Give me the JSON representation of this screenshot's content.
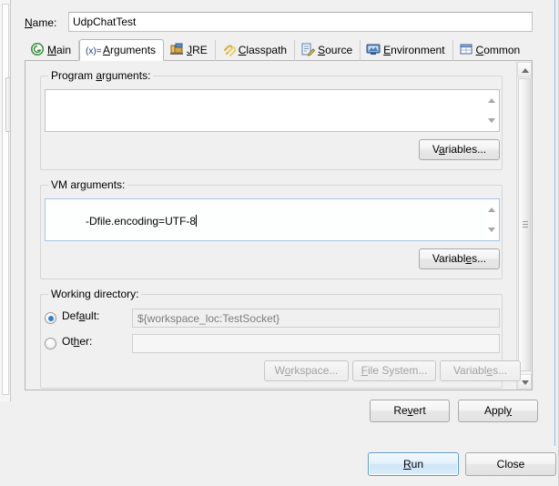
{
  "dialog": {
    "name_label": "Name:",
    "name_label_mnemonic": "N",
    "name_value": "UdpChatTest"
  },
  "tabs": [
    {
      "id": "main",
      "label": "Main",
      "mnemonic": "M",
      "icon": "green-circle-g-icon",
      "active": false
    },
    {
      "id": "arguments",
      "label": "Arguments",
      "mnemonic": "A",
      "icon": "variable-xequals-icon",
      "active": true
    },
    {
      "id": "jre",
      "label": "JRE",
      "mnemonic": "J",
      "icon": "jre-library-icon",
      "active": false
    },
    {
      "id": "classpath",
      "label": "Classpath",
      "mnemonic": "C",
      "icon": "classpath-paperclip-icon",
      "active": false
    },
    {
      "id": "source",
      "label": "Source",
      "mnemonic": "S",
      "icon": "source-pencil-icon",
      "active": false
    },
    {
      "id": "environment",
      "label": "Environment",
      "mnemonic": "E",
      "icon": "environment-monitor-icon",
      "active": false
    },
    {
      "id": "common",
      "label": "Common",
      "mnemonic": "C",
      "icon": "common-window-icon",
      "active": false
    }
  ],
  "program_arguments": {
    "group_label": "Program arguments:",
    "group_label_mnemonic": "a",
    "value": "",
    "variables_button": "Variables..."
  },
  "vm_arguments": {
    "group_label": "VM arguments:",
    "group_label_mnemonic": "g",
    "value": "-Dfile.encoding=UTF-8",
    "focused": true,
    "variables_button": "Variables..."
  },
  "working_directory": {
    "group_label": "Working directory:",
    "default_radio_label": "Default:",
    "default_radio_mnemonic": "u",
    "default_radio_selected": true,
    "default_value": "${workspace_loc:TestSocket}",
    "other_radio_label": "Other:",
    "other_radio_mnemonic": "h",
    "other_radio_selected": false,
    "other_value": "",
    "workspace_button": "Workspace...",
    "workspace_button_mnemonic": "o",
    "file_system_button": "File System...",
    "file_system_button_mnemonic": "F",
    "variables_button": "Variables...",
    "variables_button_mnemonic": "e",
    "buttons_disabled": true
  },
  "footer": {
    "revert_button": "Revert",
    "revert_mnemonic": "v",
    "apply_button": "Apply",
    "apply_mnemonic": "y",
    "run_button": "Run",
    "run_mnemonic": "R",
    "run_is_default": true,
    "close_button": "Close"
  },
  "colors": {
    "dialog_bg": "#f0f0f0",
    "field_bg": "#ffffff",
    "focus_border": "#a8c6e0",
    "default_button_border": "#5b9bd0",
    "radio_dot": "#2f7fd0",
    "readonly_text": "#7d7d7d"
  }
}
